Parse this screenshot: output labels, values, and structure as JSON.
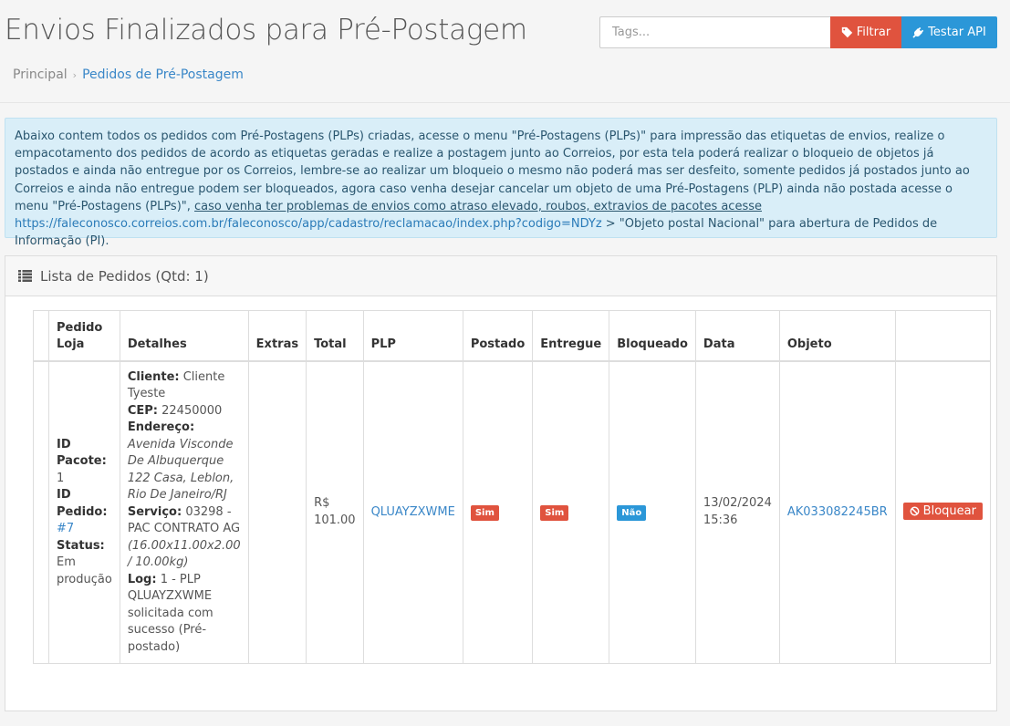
{
  "header": {
    "title": "Envios Finalizados para Pré-Postagem",
    "breadcrumb": {
      "home": "Principal",
      "separator": "›",
      "current": "Pedidos de Pré-Postagem"
    },
    "tags_placeholder": "Tags...",
    "filter_label": "Filtrar",
    "test_api_label": "Testar API"
  },
  "alert": {
    "text1": "Abaixo contem todos os pedidos com Pré-Postagens (PLPs) criadas, acesse o menu \"Pré-Postagens (PLPs)\" para impressão das etiquetas de envios, realize o empacotamento dos pedidos de acordo as etiquetas geradas e realize a postagem junto ao Correios, por esta tela poderá realizar o bloqueio de objetos já postados e ainda não entregue por os Correios, lembre-se ao realizar um bloqueio o mesmo não poderá mas ser desfeito, somente pedidos já postados junto ao Correios e ainda não entregue podem ser bloqueados, agora caso venha desejar cancelar um objeto de uma Pré-Postagens (PLP) ainda não postada acesse o menu \"Pré-Postagens (PLPs)\", ",
    "underline": "caso venha ter problemas de envios como atraso elevado, roubos, extravios de pacotes acesse",
    "link": "https://faleconosco.correios.com.br/faleconosco/app/cadastro/reclamacao/index.php?codigo=NDYz",
    "text2": " > \"Objeto postal Nacional\" para abertura de Pedidos de Informação (PI)."
  },
  "panel": {
    "title": "Lista de Pedidos (Qtd: 1)"
  },
  "table": {
    "columns": [
      "Pedido Loja",
      "Detalhes",
      "Extras",
      "Total",
      "PLP",
      "Postado",
      "Entregue",
      "Bloqueado",
      "Data",
      "Objeto",
      ""
    ],
    "rows": [
      {
        "pedido_loja": {
          "id_pacote_label": "ID Pacote:",
          "id_pacote": "1",
          "id_pedido_label": "ID Pedido:",
          "id_pedido": "#7",
          "status_label": "Status:",
          "status": "Em produção"
        },
        "detalhes": {
          "cliente_label": "Cliente:",
          "cliente": "Cliente Tyeste",
          "cep_label": "CEP:",
          "cep": "22450000",
          "endereco_label": "Endereço:",
          "endereco": "Avenida Visconde De Albuquerque 122 Casa, Leblon, Rio De Janeiro/RJ",
          "servico_label": "Serviço:",
          "servico": "03298 - PAC CONTRATO AG",
          "dimensoes": "(16.00x11.00x2.00 / 10.00kg)",
          "log_label": "Log:",
          "log": "1 - PLP QLUAYZXWME solicitada com sucesso (Pré-postado)"
        },
        "extras": "",
        "total": "R$ 101.00",
        "plp": "QLUAYZXWME",
        "postado": "Sim",
        "entregue": "Sim",
        "bloqueado": "Não",
        "data": "13/02/2024 15:36",
        "objeto": "AK033082245BR",
        "action_label": "Bloquear"
      }
    ]
  },
  "colors": {
    "danger": "#e0533e",
    "primary": "#2b97d8",
    "link": "#3a87c8",
    "alert_bg": "#d9eef8"
  }
}
